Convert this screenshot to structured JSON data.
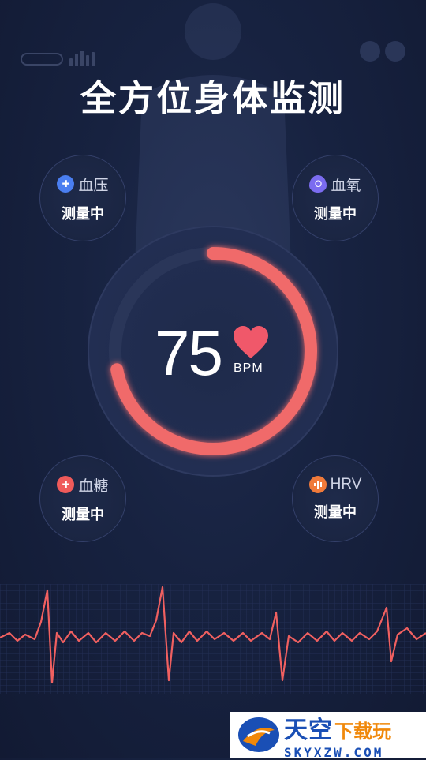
{
  "title": "全方位身体监测",
  "metrics": {
    "blood_pressure": {
      "label": "血压",
      "status": "测量中",
      "icon": "blood-pressure-icon",
      "color": "#4a7ef0"
    },
    "blood_oxygen": {
      "label": "血氧",
      "status": "测量中",
      "icon": "blood-oxygen-icon",
      "color": "#7b6cf0"
    },
    "blood_sugar": {
      "label": "血糖",
      "status": "测量中",
      "icon": "blood-sugar-icon",
      "color": "#ef5a5a"
    },
    "hrv": {
      "label": "HRV",
      "status": "测量中",
      "icon": "hrv-icon",
      "color": "#f07a3a"
    }
  },
  "heart_rate": {
    "value": "75",
    "unit": "BPM",
    "progress": 0.72,
    "color": "#f06a6a"
  },
  "watermark": {
    "logo_text": "天空",
    "logo_text_2": "下载玩",
    "sub_text": "SKYXZW.COM"
  }
}
